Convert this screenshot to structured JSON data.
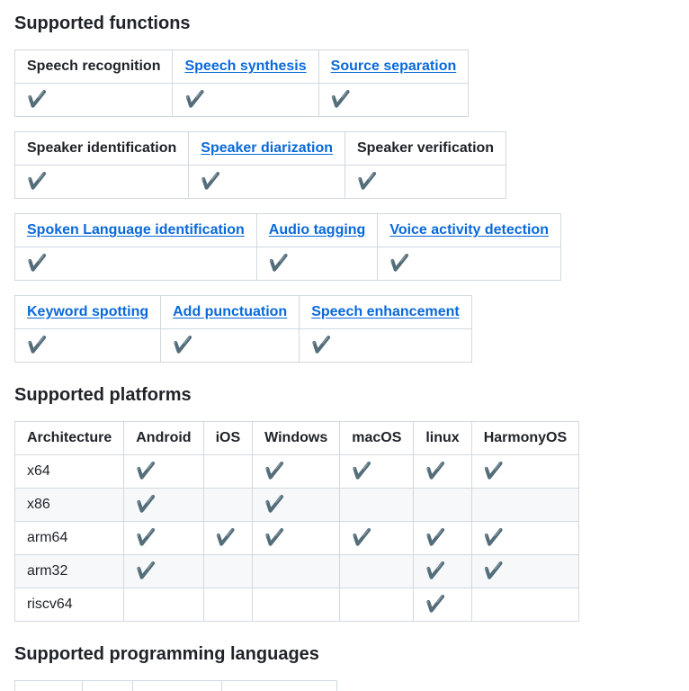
{
  "headings": {
    "functions": "Supported functions",
    "platforms": "Supported platforms",
    "languages": "Supported programming languages"
  },
  "check_glyph": "✔️",
  "function_tables": [
    {
      "headers": [
        {
          "label": "Speech recognition",
          "link": false
        },
        {
          "label": "Speech synthesis",
          "link": true
        },
        {
          "label": "Source separation",
          "link": true
        }
      ],
      "supported": [
        true,
        true,
        true
      ]
    },
    {
      "headers": [
        {
          "label": "Speaker identification",
          "link": false
        },
        {
          "label": "Speaker diarization",
          "link": true
        },
        {
          "label": "Speaker verification",
          "link": false
        }
      ],
      "supported": [
        true,
        true,
        true
      ]
    },
    {
      "headers": [
        {
          "label": "Spoken Language identification",
          "link": true
        },
        {
          "label": "Audio tagging",
          "link": true
        },
        {
          "label": "Voice activity detection",
          "link": true
        }
      ],
      "supported": [
        true,
        true,
        true
      ]
    },
    {
      "headers": [
        {
          "label": "Keyword spotting",
          "link": true
        },
        {
          "label": "Add punctuation",
          "link": true
        },
        {
          "label": "Speech enhancement",
          "link": true
        }
      ],
      "supported": [
        true,
        true,
        true
      ]
    }
  ],
  "platforms": {
    "headers": [
      "Architecture",
      "Android",
      "iOS",
      "Windows",
      "macOS",
      "linux",
      "HarmonyOS"
    ],
    "rows": [
      {
        "arch": "x64",
        "support": [
          true,
          false,
          true,
          true,
          true,
          true
        ]
      },
      {
        "arch": "x86",
        "support": [
          true,
          false,
          true,
          false,
          false,
          false
        ]
      },
      {
        "arch": "arm64",
        "support": [
          true,
          true,
          true,
          true,
          true,
          true
        ]
      },
      {
        "arch": "arm32",
        "support": [
          true,
          false,
          false,
          false,
          true,
          true
        ]
      },
      {
        "arch": "riscv64",
        "support": [
          false,
          false,
          false,
          false,
          true,
          false
        ]
      }
    ]
  }
}
